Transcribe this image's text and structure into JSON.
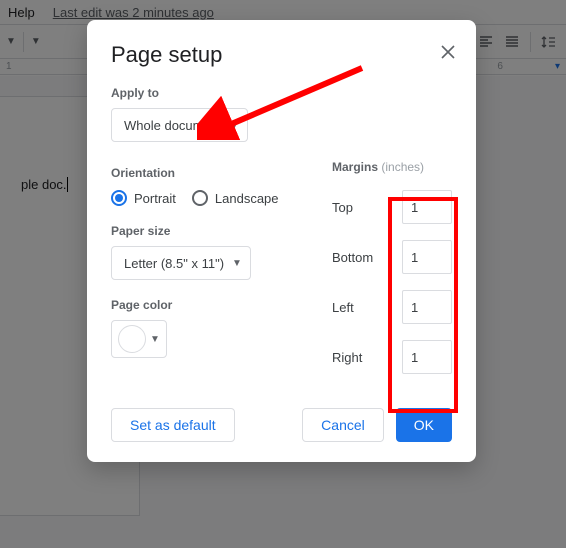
{
  "menubar": {
    "help": "Help",
    "last_edit": "Last edit was 2 minutes ago"
  },
  "ruler": {
    "marks": [
      "1",
      "6"
    ]
  },
  "doc": {
    "sample_text": "ple doc."
  },
  "dialog": {
    "title": "Page setup",
    "apply_to_label": "Apply to",
    "apply_to_value": "Whole document",
    "orientation_label": "Orientation",
    "orientation_portrait": "Portrait",
    "orientation_landscape": "Landscape",
    "paper_size_label": "Paper size",
    "paper_size_value": "Letter (8.5\" x 11\")",
    "page_color_label": "Page color",
    "margins_label": "Margins",
    "margins_unit": "(inches)",
    "margins": {
      "top_label": "Top",
      "top_value": "1",
      "bottom_label": "Bottom",
      "bottom_value": "1",
      "left_label": "Left",
      "left_value": "1",
      "right_label": "Right",
      "right_value": "1"
    },
    "set_default": "Set as default",
    "cancel": "Cancel",
    "ok": "OK"
  }
}
